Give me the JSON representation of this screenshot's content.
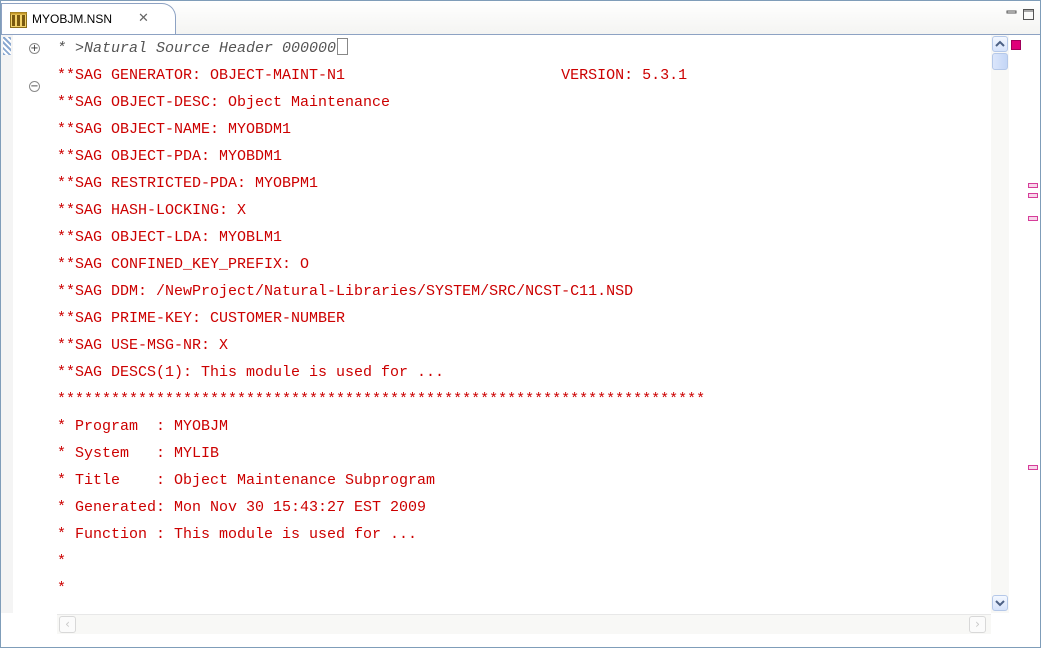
{
  "tab": {
    "title": "MYOBJM.NSN",
    "close_symbol": "✕"
  },
  "editor": {
    "header_line": "* >Natural Source Header 000000",
    "lines": [
      "**SAG GENERATOR: OBJECT-MAINT-N1                        VERSION: 5.3.1",
      "**SAG OBJECT-DESC: Object Maintenance",
      "**SAG OBJECT-NAME: MYOBDM1",
      "**SAG OBJECT-PDA: MYOBDM1",
      "**SAG RESTRICTED-PDA: MYOBPM1",
      "**SAG HASH-LOCKING: X",
      "**SAG OBJECT-LDA: MYOBLM1",
      "**SAG CONFINED_KEY_PREFIX: O",
      "**SAG DDM: /NewProject/Natural-Libraries/SYSTEM/SRC/NCST-C11.NSD",
      "**SAG PRIME-KEY: CUSTOMER-NUMBER",
      "**SAG USE-MSG-NR: X",
      "**SAG DESCS(1): This module is used for ...",
      "************************************************************************",
      "* Program  : MYOBJM",
      "* System   : MYLIB",
      "* Title    : Object Maintenance Subprogram",
      "* Generated: Mon Nov 30 15:43:27 EST 2009",
      "* Function : This module is used for ...",
      "*",
      "*"
    ]
  },
  "colors": {
    "code": "#cc0000",
    "header_comment": "#555555",
    "overview_marker": "#d63d9a",
    "error_marker": "#e0007a"
  },
  "icons": {
    "tab_icon": "natural-source-file-icon",
    "minimize": "minimize-icon",
    "maximize": "maximize-icon"
  }
}
